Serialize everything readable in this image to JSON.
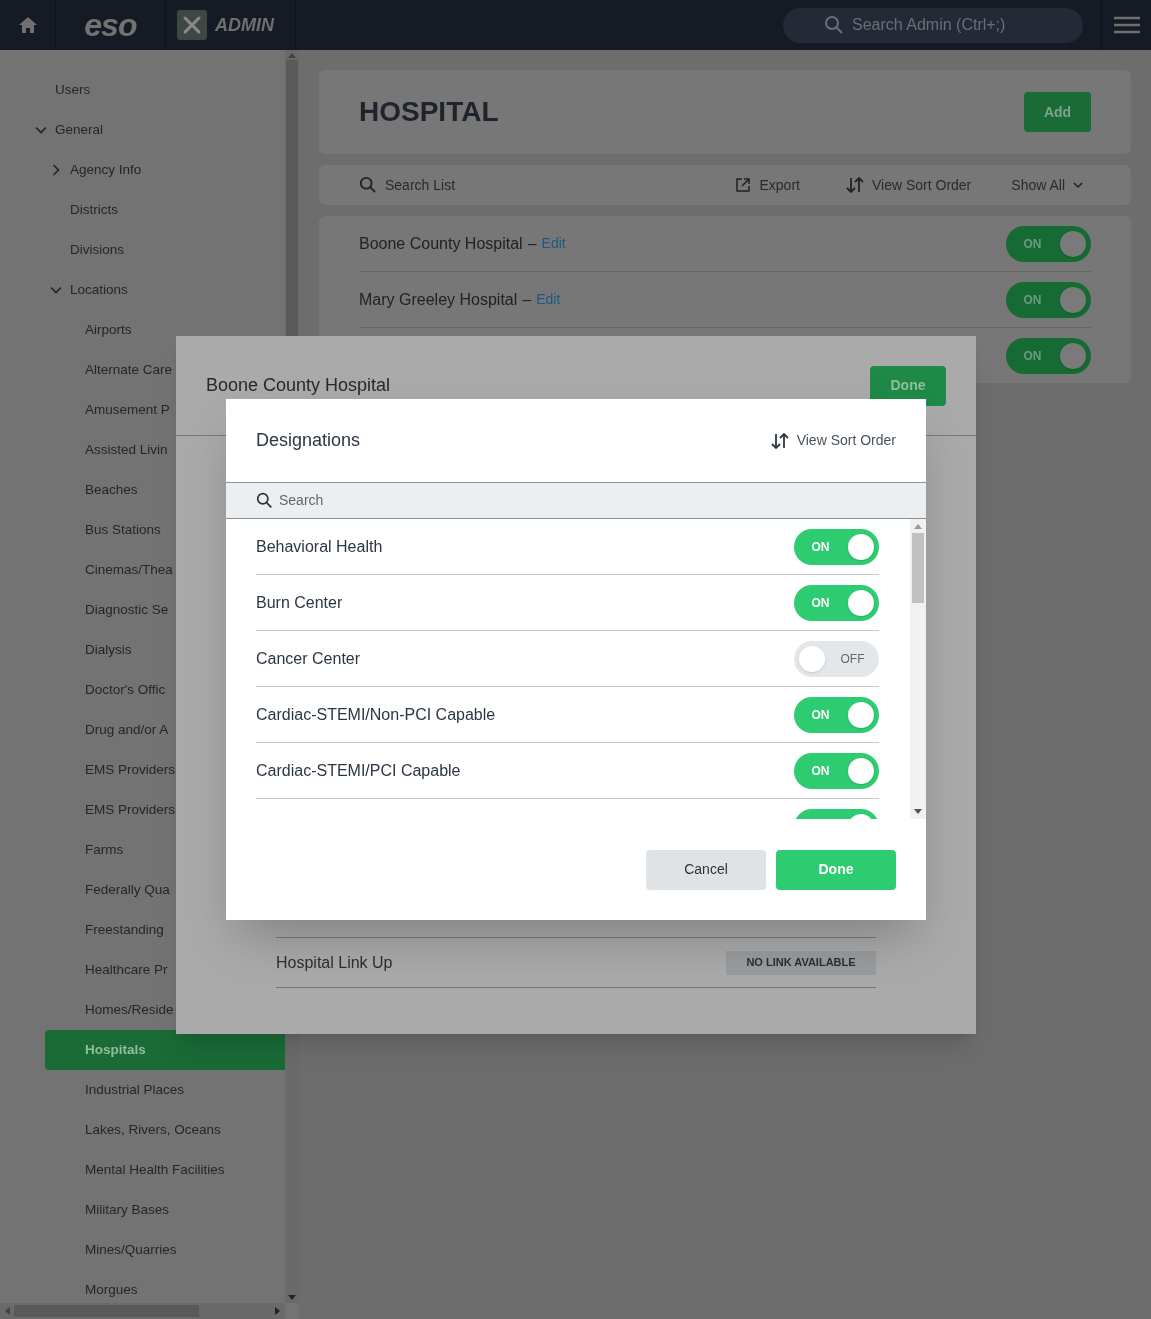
{
  "header": {
    "logo": "eso",
    "app": "ADMIN",
    "search_placeholder": "Search Admin (Ctrl+;)"
  },
  "sidebar": {
    "items": [
      {
        "label": "Users",
        "selected": false
      },
      {
        "label": "General",
        "expanded": true,
        "selected": false,
        "children": [
          {
            "label": "Agency Info",
            "expanded": false,
            "selected": false
          },
          {
            "label": "Districts",
            "selected": false
          },
          {
            "label": "Divisions",
            "selected": false
          },
          {
            "label": "Locations",
            "expanded": true,
            "selected": false,
            "children": [
              {
                "label": "Airports",
                "selected": false
              },
              {
                "label": "Alternate Care",
                "selected": false
              },
              {
                "label": "Amusement P",
                "selected": false
              },
              {
                "label": "Assisted Livin",
                "selected": false
              },
              {
                "label": "Beaches",
                "selected": false
              },
              {
                "label": "Bus Stations",
                "selected": false
              },
              {
                "label": "Cinemas/Thea",
                "selected": false
              },
              {
                "label": "Diagnostic Se",
                "selected": false
              },
              {
                "label": "Dialysis",
                "selected": false
              },
              {
                "label": "Doctor's Offic",
                "selected": false
              },
              {
                "label": "Drug and/or A",
                "selected": false
              },
              {
                "label": "EMS Providers",
                "selected": false
              },
              {
                "label": "EMS Providers",
                "selected": false
              },
              {
                "label": "Farms",
                "selected": false
              },
              {
                "label": "Federally Qua",
                "selected": false
              },
              {
                "label": "Freestanding",
                "selected": false
              },
              {
                "label": "Healthcare Pr",
                "selected": false
              },
              {
                "label": "Homes/Reside",
                "selected": false
              },
              {
                "label": "Hospitals",
                "selected": true
              },
              {
                "label": "Industrial Places",
                "selected": false
              },
              {
                "label": "Lakes, Rivers, Oceans",
                "selected": false
              },
              {
                "label": "Mental Health Facilities",
                "selected": false
              },
              {
                "label": "Military Bases",
                "selected": false
              },
              {
                "label": "Mines/Quarries",
                "selected": false
              },
              {
                "label": "Morgues",
                "selected": false
              }
            ]
          }
        ]
      }
    ]
  },
  "page": {
    "title": "HOSPITAL",
    "add_button": "Add",
    "toolbar": {
      "search": "Search List",
      "export": "Export",
      "sort": "View Sort Order",
      "filter": "Show All"
    },
    "rows": [
      {
        "name": "Boone County Hospital",
        "separator": "–",
        "edit": "Edit",
        "on": true,
        "toggle_text": "ON"
      },
      {
        "name": "Mary Greeley Hospital",
        "separator": "–",
        "edit": "Edit",
        "on": true,
        "toggle_text": "ON"
      },
      {
        "on": true,
        "toggle_text": "ON"
      }
    ]
  },
  "detail_dialog": {
    "title": "Boone County Hospital",
    "done": "Done",
    "rows": [
      {
        "label": "Hospital Link Up",
        "value": "NO LINK AVAILABLE"
      }
    ]
  },
  "designations_dialog": {
    "title": "Designations",
    "sort": "View Sort Order",
    "search_placeholder": "Search",
    "items": [
      {
        "label": "Behavioral Health",
        "on": true,
        "toggle_text": "ON"
      },
      {
        "label": "Burn Center",
        "on": true,
        "toggle_text": "ON"
      },
      {
        "label": "Cancer Center",
        "on": false,
        "toggle_text": "OFF"
      },
      {
        "label": "Cardiac-STEMI/Non-PCI Capable",
        "on": true,
        "toggle_text": "ON"
      },
      {
        "label": "Cardiac-STEMI/PCI Capable",
        "on": true,
        "toggle_text": "ON"
      },
      {
        "on": true
      }
    ],
    "cancel": "Cancel",
    "done": "Done"
  }
}
